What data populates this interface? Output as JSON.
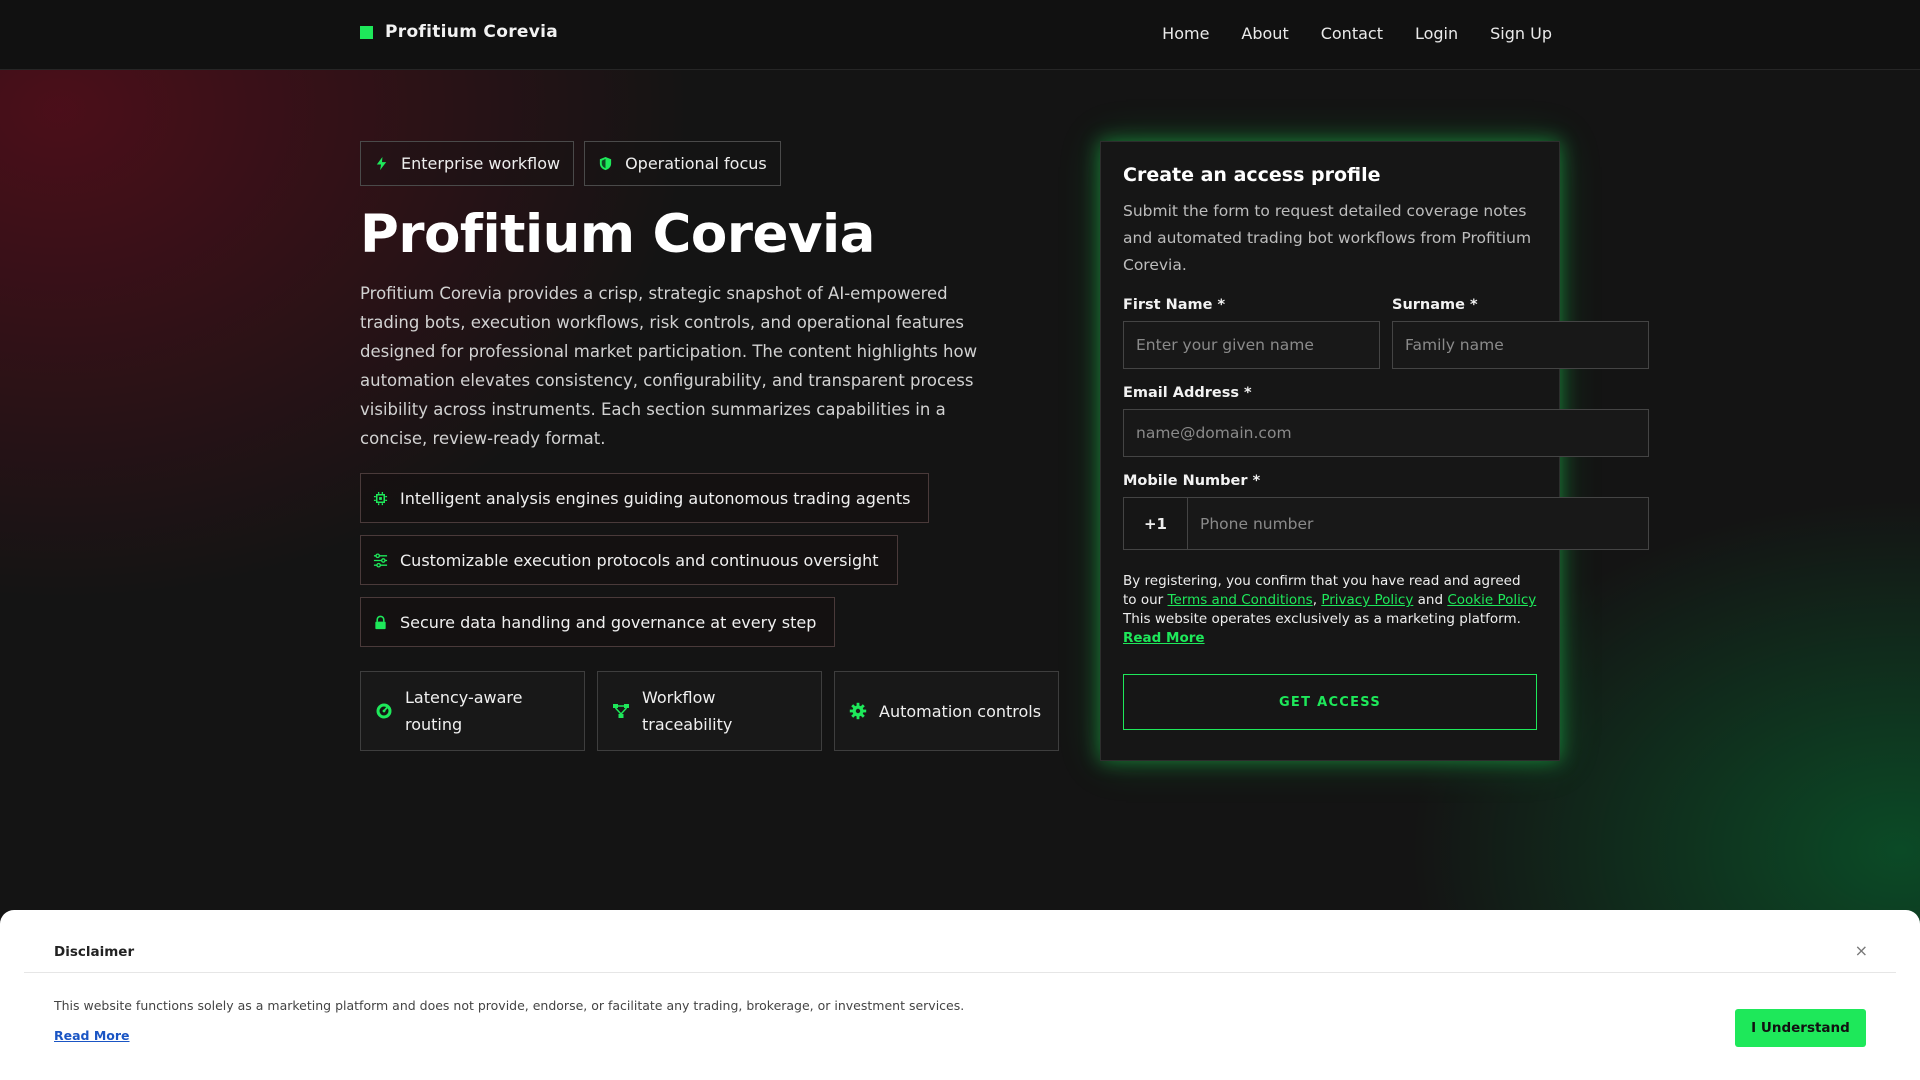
{
  "header": {
    "brand": "Profitium Corevia",
    "nav": [
      "Home",
      "About",
      "Contact",
      "Login",
      "Sign Up"
    ]
  },
  "hero": {
    "chips": [
      "Enterprise workflow",
      "Operational focus"
    ],
    "title": "Profitium Corevia",
    "description": "Profitium Corevia provides a crisp, strategic snapshot of AI-empowered trading bots, execution workflows, risk controls, and operational features designed for professional market participation. The content highlights how automation elevates consistency, configurability, and transparent process visibility across instruments. Each section summarizes capabilities in a concise, review-ready format.",
    "features": [
      "Intelligent analysis engines guiding autonomous trading agents",
      "Customizable execution protocols and continuous oversight",
      "Secure data handling and governance at every step"
    ],
    "cards": [
      "Latency-aware routing",
      "Workflow traceability",
      "Automation controls"
    ]
  },
  "form": {
    "title": "Create an access profile",
    "subtitle": "Submit the form to request detailed coverage notes and automated trading bot workflows from Profitium Corevia.",
    "first_name_label": "First Name *",
    "first_name_placeholder": "Enter your given name",
    "surname_label": "Surname *",
    "surname_placeholder": "Family name",
    "email_label": "Email Address *",
    "email_placeholder": "name@domain.com",
    "mobile_label": "Mobile Number *",
    "mobile_code": "+1",
    "mobile_placeholder": "Phone number",
    "terms_prefix": "By registering, you confirm that you have read and agreed to our",
    "terms_link": "Terms and Conditions",
    "privacy_link": "Privacy Policy",
    "terms_and": "and",
    "cookie_link": "Cookie Policy",
    "terms_suffix": "This website operates exclusively as a marketing platform.",
    "read_more": "Read More",
    "submit": "GET ACCESS"
  },
  "disclaimer": {
    "title": "Disclaimer",
    "close": "×",
    "text": "This website functions solely as a marketing platform and does not provide, endorse, or facilitate any trading, brokerage, or investment services.",
    "read_more": "Read More",
    "button": "I Understand"
  },
  "colors": {
    "accent": "#1ee85a",
    "background": "#121212",
    "link_blue": "#1a55c4"
  }
}
